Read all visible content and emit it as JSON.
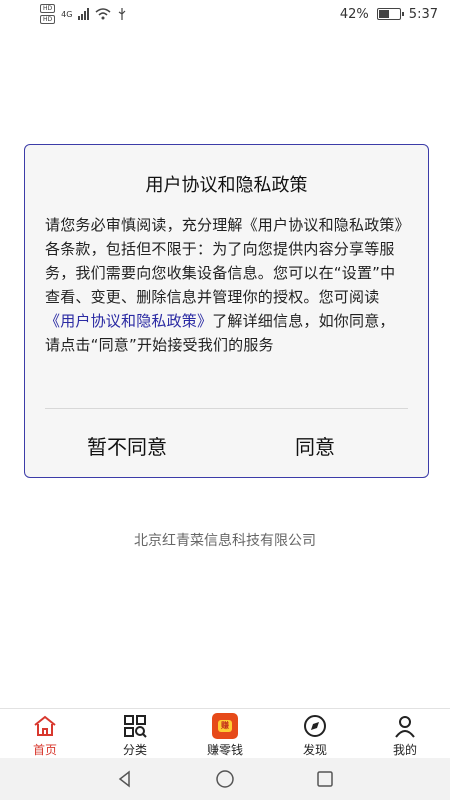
{
  "status_bar": {
    "hd_badges": [
      "HD",
      "HD"
    ],
    "net_type": "4G",
    "battery_text": "42%",
    "time": "5:37"
  },
  "dialog": {
    "title": "用户协议和隐私政策",
    "body_part1": "请您务必审慎阅读，充分理解《用户协议和隐私政策》各条款，包括但不限于：为了向您提供内容分享等服务，我们需要向您收集设备信息。您可以在“设置”中查看、变更、删除信息并管理你的授权。您可阅读",
    "body_link": "《用户协议和隐私政策》",
    "body_part2": "了解详细信息，如你同意，请点击“同意”开始接受我们的服务",
    "disagree_label": "暂不同意",
    "agree_label": "同意"
  },
  "company_name": "北京红青菜信息科技有限公司",
  "bottom_nav": [
    {
      "label": "首页",
      "icon": "home-icon",
      "active": true
    },
    {
      "label": "分类",
      "icon": "category-search-icon"
    },
    {
      "label": "赚零钱",
      "icon": "earn-money-icon"
    },
    {
      "label": "发现",
      "icon": "compass-icon"
    },
    {
      "label": "我的",
      "icon": "user-icon"
    }
  ],
  "colors": {
    "accent": "#d8382e",
    "dialog_border": "#3c3ca8",
    "link": "#2a2aa3"
  }
}
